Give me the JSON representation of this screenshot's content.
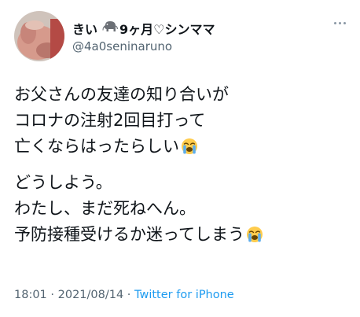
{
  "author": {
    "display_name": "きい　🐘9ヶ月♡シンママ",
    "name_text": "きい",
    "badge_icon": "elephant-icon",
    "name_suffix": "9ヶ月♡シンママ",
    "handle": "@4a0seninaruno"
  },
  "tweet": {
    "paragraph1": [
      "お父さんの友達の知り合いが",
      "コロナの注射2回目打って",
      "亡くならはったらしい"
    ],
    "paragraph2": [
      "どうしよう。",
      "わたし、まだ死ねへん。",
      "予防接種受けるか迷ってしまう"
    ],
    "emoji_icon": "loudly-crying-face-icon"
  },
  "meta": {
    "time": "18:01",
    "separator": " · ",
    "date": "2021/08/14",
    "source": "Twitter for iPhone"
  },
  "colors": {
    "text": "#0f1419",
    "secondary": "#536471",
    "link": "#1d9bf0"
  }
}
